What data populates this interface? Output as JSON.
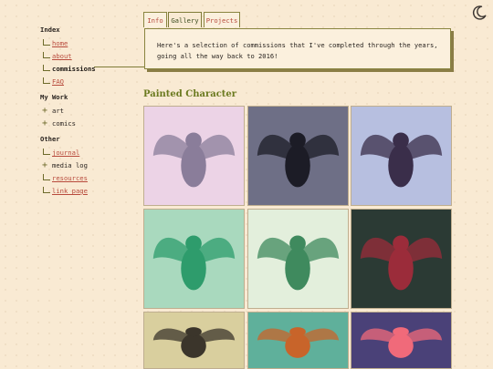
{
  "theme_toggle": {
    "icon": "moon-icon"
  },
  "sidebar": {
    "sections": [
      {
        "title": "Index",
        "items": [
          {
            "label": "home",
            "style": "link",
            "marker": "branch"
          },
          {
            "label": "about",
            "style": "link",
            "marker": "branch"
          },
          {
            "label": "commissions",
            "style": "current",
            "marker": "branch"
          },
          {
            "label": "FAQ",
            "style": "link",
            "marker": "branch"
          }
        ]
      },
      {
        "title": "My Work",
        "items": [
          {
            "label": "art",
            "style": "plain",
            "marker": "plus"
          },
          {
            "label": "comics",
            "style": "plain",
            "marker": "plus"
          }
        ]
      },
      {
        "title": "Other",
        "items": [
          {
            "label": "journal",
            "style": "link",
            "marker": "branch"
          },
          {
            "label": "media log",
            "style": "plain",
            "marker": "plus"
          },
          {
            "label": "resources",
            "style": "link",
            "marker": "branch"
          },
          {
            "label": "link page",
            "style": "link",
            "marker": "branch"
          }
        ]
      }
    ]
  },
  "tabs": [
    {
      "label": "Info",
      "active": false
    },
    {
      "label": "Gallery",
      "active": true
    },
    {
      "label": "Projects",
      "active": false
    }
  ],
  "panel": {
    "text": "Here's a selection of commissions that I've completed through the years, going all the way back to 2016!"
  },
  "gallery": {
    "title": "Painted Character",
    "items": [
      {
        "subject": "winged-character-pink",
        "bg": "#ecd3e6",
        "accent": "#8a7d9a"
      },
      {
        "subject": "dark-bird-flying",
        "bg": "#6e6f86",
        "accent": "#1c1c26"
      },
      {
        "subject": "dark-winged-dragon",
        "bg": "#b7bfe0",
        "accent": "#3a2e4a"
      },
      {
        "subject": "phoenix-green-dragon",
        "bg": "#a9d9be",
        "accent": "#2e9c6c"
      },
      {
        "subject": "green-serpent-dragon",
        "bg": "#e3efdc",
        "accent": "#3f8a5e"
      },
      {
        "subject": "plaid-cat-character",
        "bg": "#2b3a34",
        "accent": "#9b2c3a"
      },
      {
        "subject": "reclining-character",
        "bg": "#d9cf9e",
        "accent": "#3b352b"
      },
      {
        "subject": "red-panda",
        "bg": "#5fb09b",
        "accent": "#c8642a"
      },
      {
        "subject": "pink-phoenix",
        "bg": "#4a4178",
        "accent": "#f06a7a"
      }
    ]
  }
}
